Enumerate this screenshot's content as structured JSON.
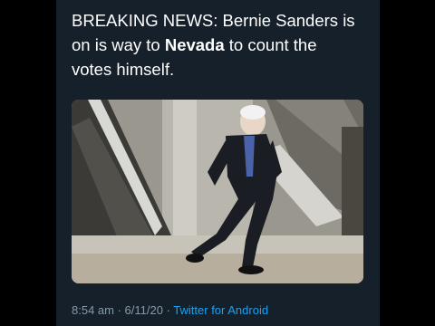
{
  "tweet": {
    "text_line1": "BREAKING NEWS: Bernie Sanders is",
    "text_line2_pre": "on is way to ",
    "text_line2_bold": "Nevada",
    "text_line2_post": " to count the",
    "text_line3": "votes himself."
  },
  "meta": {
    "time": "8:54 am",
    "separator": " · ",
    "date": "6/11/20",
    "separator2": " · ",
    "source": "Twitter for Android"
  },
  "colors": {
    "background": "#15202b",
    "text": "#ffffff",
    "muted": "#8899a6",
    "link": "#1da1f2"
  }
}
